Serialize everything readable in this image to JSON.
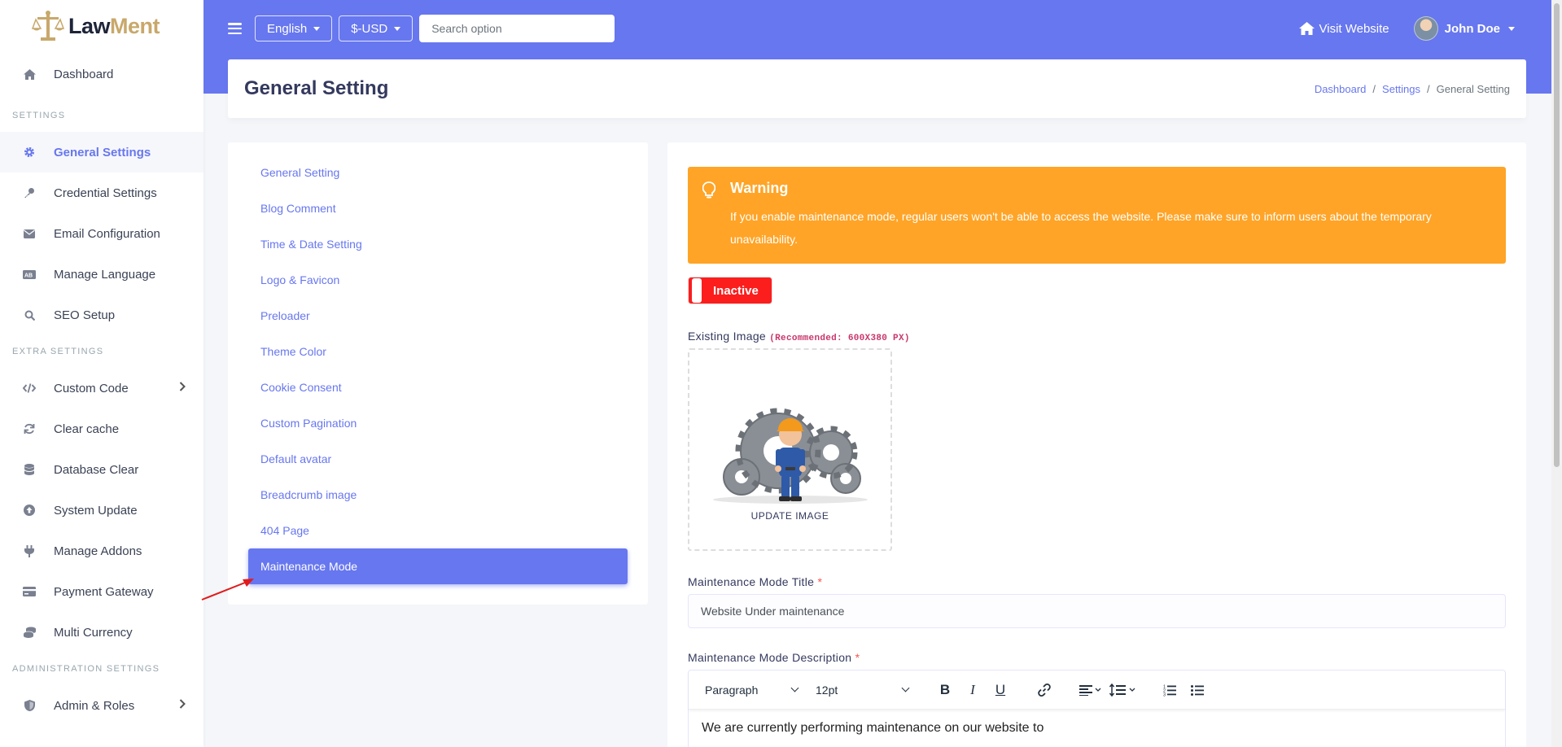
{
  "brand": {
    "name_part1": "Law",
    "name_part2": "Ment"
  },
  "sidebar": {
    "dashboard": "Dashboard",
    "header_settings": "SETTINGS",
    "settings_items": [
      "General Settings",
      "Credential Settings",
      "Email Configuration",
      "Manage Language",
      "SEO Setup"
    ],
    "header_extra": "EXTRA SETTINGS",
    "extra_items": [
      "Custom Code",
      "Clear cache",
      "Database Clear",
      "System Update",
      "Manage Addons",
      "Payment Gateway",
      "Multi Currency"
    ],
    "header_admin": "ADMINISTRATION SETTINGS",
    "admin_items": [
      "Admin & Roles"
    ]
  },
  "navbar": {
    "language": "English",
    "currency": "$-USD",
    "search_placeholder": "Search option",
    "visit_website": "Visit Website",
    "user_name": "John Doe"
  },
  "page": {
    "title": "General Setting",
    "breadcrumb": [
      "Dashboard",
      "Settings",
      "General Setting"
    ]
  },
  "settings_nav": [
    "General Setting",
    "Blog Comment",
    "Time & Date Setting",
    "Logo & Favicon",
    "Preloader",
    "Theme Color",
    "Cookie Consent",
    "Custom Pagination",
    "Default avatar",
    "Breadcrumb image",
    "404 Page",
    "Maintenance Mode"
  ],
  "maintenance": {
    "warning_title": "Warning",
    "warning_text": "If you enable maintenance mode, regular users won't be able to access the website. Please make sure to inform users about the temporary unavailability.",
    "toggle_label": "Inactive",
    "image_label": "Existing Image",
    "image_recommended": "(Recommended: 600X380 PX)",
    "update_image": "UPDATE IMAGE",
    "title_label": "Maintenance Mode Title",
    "title_value": "Website Under maintenance",
    "desc_label": "Maintenance Mode Description",
    "editor_block": "Paragraph",
    "editor_size": "12pt",
    "editor_content": "We are currently performing maintenance on our website to"
  },
  "colors": {
    "primary": "#6777ef",
    "warning": "#ffa426",
    "danger": "#fc1d1d",
    "brand_gold": "#c8a86b"
  }
}
